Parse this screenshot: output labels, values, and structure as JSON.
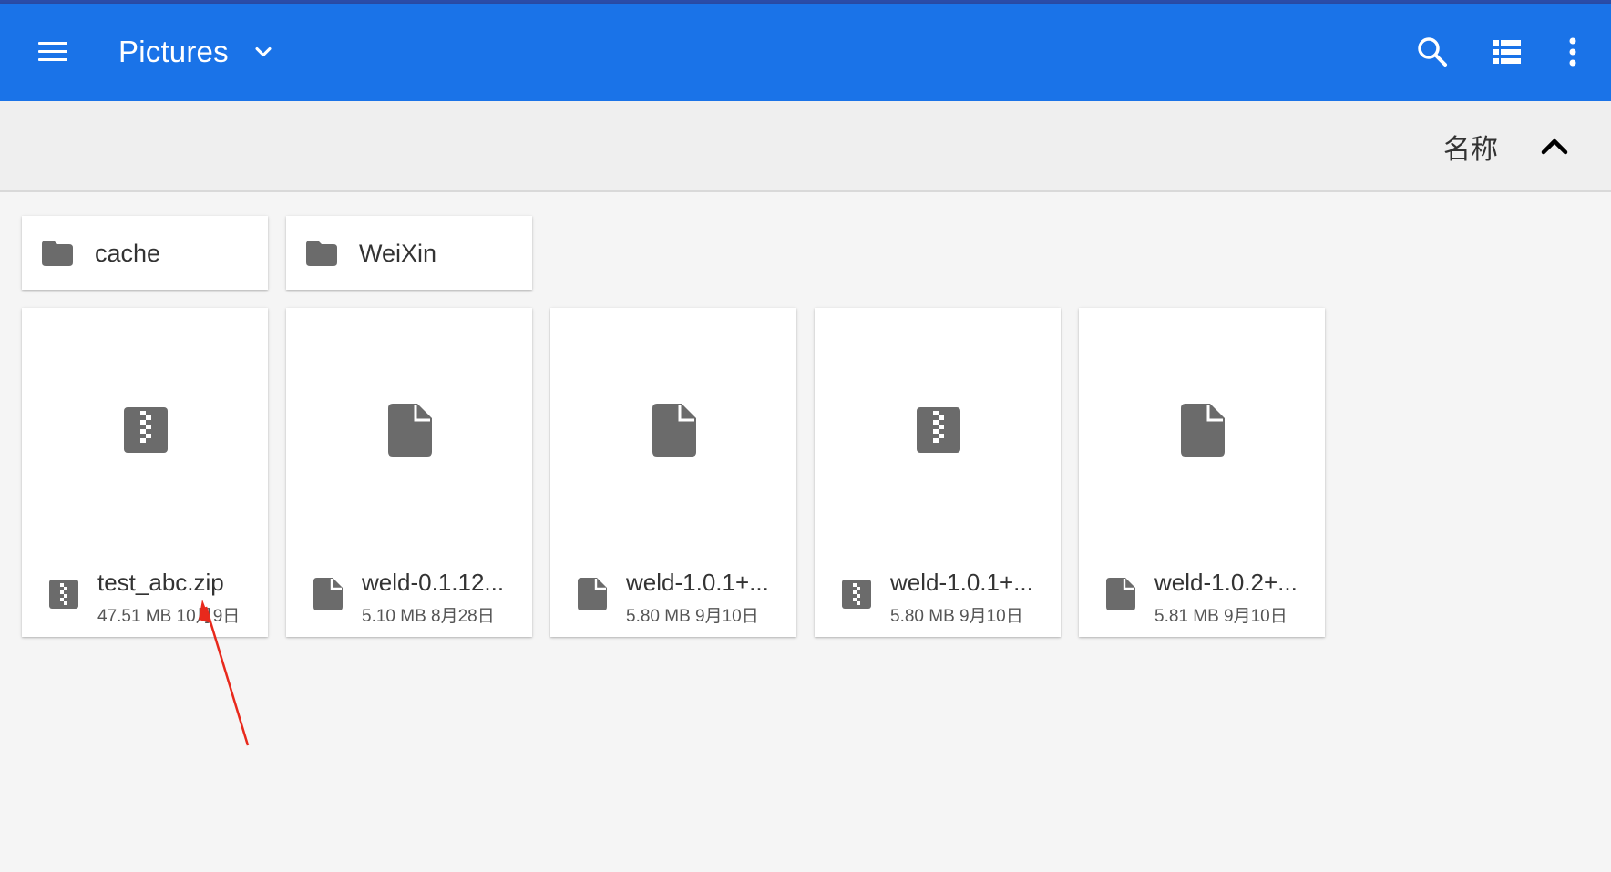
{
  "appbar": {
    "title": "Pictures",
    "menu_icon": "hamburger-menu-icon",
    "dropdown_icon": "chevron-down-icon",
    "search_icon": "search-icon",
    "view_icon": "list-view-icon",
    "more_icon": "more-vert-icon"
  },
  "sortbar": {
    "label": "名称",
    "direction_icon": "chevron-up-icon"
  },
  "folders": [
    {
      "name": "cache",
      "icon": "folder-icon"
    },
    {
      "name": "WeiXin",
      "icon": "folder-icon"
    }
  ],
  "files": [
    {
      "name": "test_abc.zip",
      "size": "47.51 MB",
      "date": "10月9日",
      "icon": "archive-icon"
    },
    {
      "name": "weld-0.1.12...",
      "size": "5.10 MB",
      "date": "8月28日",
      "icon": "document-icon"
    },
    {
      "name": "weld-1.0.1+...",
      "size": "5.80 MB",
      "date": "9月10日",
      "icon": "document-icon"
    },
    {
      "name": "weld-1.0.1+...",
      "size": "5.80 MB",
      "date": "9月10日",
      "icon": "archive-icon"
    },
    {
      "name": "weld-1.0.2+...",
      "size": "5.81 MB",
      "date": "9月10日",
      "icon": "document-icon"
    }
  ],
  "colors": {
    "appbar": "#1a73e8",
    "icon_gray": "#6b6b6b",
    "annotation_arrow": "#e8291c"
  }
}
